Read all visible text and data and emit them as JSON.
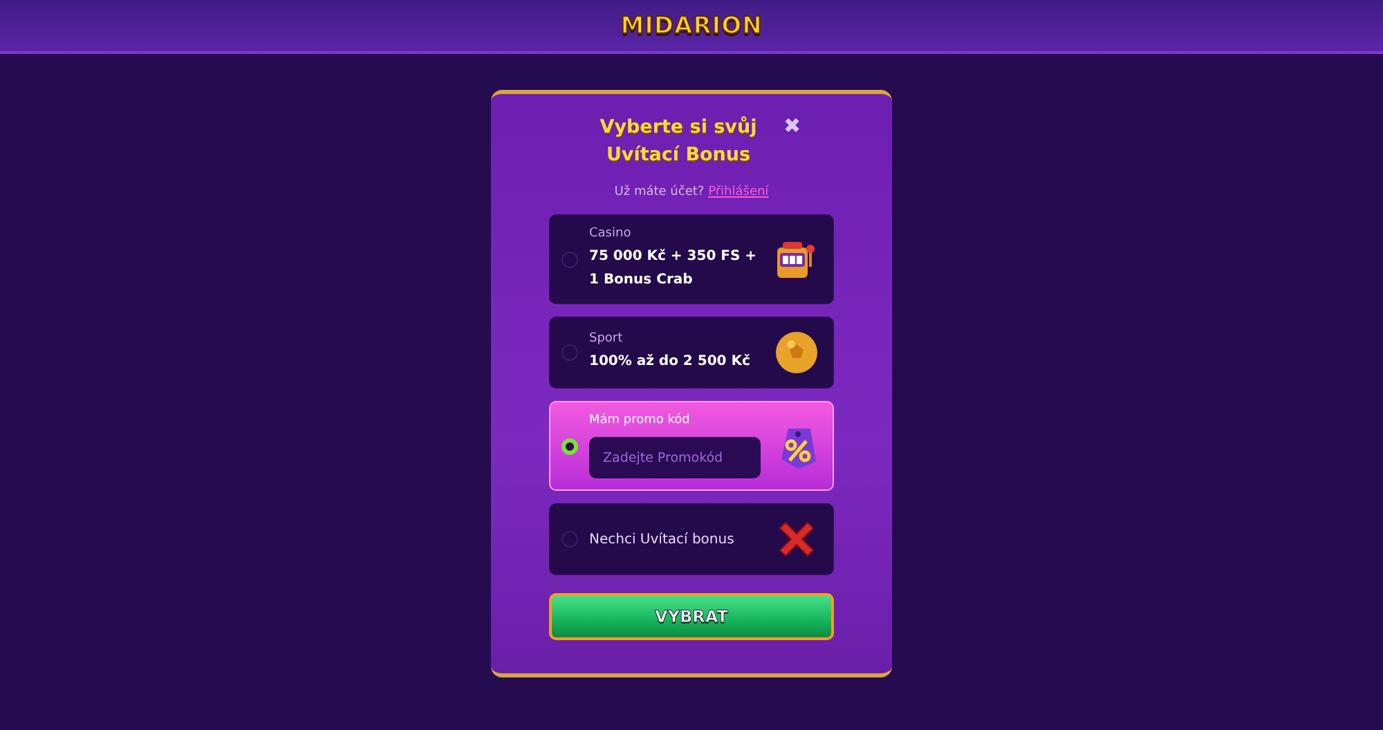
{
  "header": {
    "logo": "MIDARION"
  },
  "modal": {
    "title": "Vyberte si svůj Uvítací Bonus",
    "close": "✖",
    "login_prompt": "Už máte účet?",
    "login_link": "Přihlášení",
    "options": [
      {
        "kind": "bonus",
        "label": "Casino",
        "text": "75 000 Kč + 350 FS + 1 Bonus Crab",
        "selected": false
      },
      {
        "kind": "bonus",
        "label": "Sport",
        "text": "100% až do 2 500 Kč",
        "selected": false
      },
      {
        "kind": "promo",
        "label": "Mám promo kód",
        "placeholder": "Zadejte Promokód",
        "selected": true
      },
      {
        "kind": "plain",
        "text": "Nechci Uvítací bonus",
        "selected": false
      }
    ],
    "submit": "VYBRAT"
  }
}
